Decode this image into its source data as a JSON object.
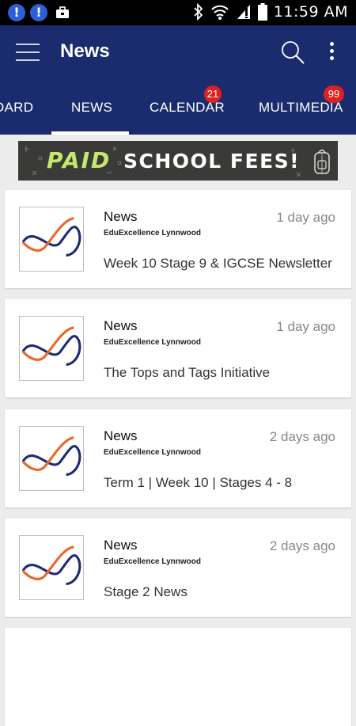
{
  "status_bar": {
    "time": "11:59 AM"
  },
  "app_bar": {
    "title": "News"
  },
  "tabs": [
    {
      "label": "DASHBOARD",
      "visible_label": "OARD"
    },
    {
      "label": "NEWS"
    },
    {
      "label": "CALENDAR",
      "badge": "21"
    },
    {
      "label": "MULTIMEDIA",
      "badge": "99"
    }
  ],
  "banner": {
    "paid": "PAID",
    "text": "SCHOOL FEES!"
  },
  "colors": {
    "primary": "#1a2c6d",
    "badge": "#e02020",
    "logo_navy": "#1f2c74",
    "logo_orange": "#e8692a"
  },
  "news": [
    {
      "title": "News",
      "source": "EduExcellence Lynnwood",
      "time": "1 day ago",
      "headline": "Week 10 Stage 9 & IGCSE Newsletter"
    },
    {
      "title": "News",
      "source": "EduExcellence Lynnwood",
      "time": "1 day ago",
      "headline": "The Tops and Tags Initiative"
    },
    {
      "title": "News",
      "source": "EduExcellence Lynnwood",
      "time": "2 days ago",
      "headline": "Term 1 | Week 10 | Stages 4 - 8"
    },
    {
      "title": "News",
      "source": "EduExcellence Lynnwood",
      "time": "2 days ago",
      "headline": "Stage 2 News"
    }
  ]
}
